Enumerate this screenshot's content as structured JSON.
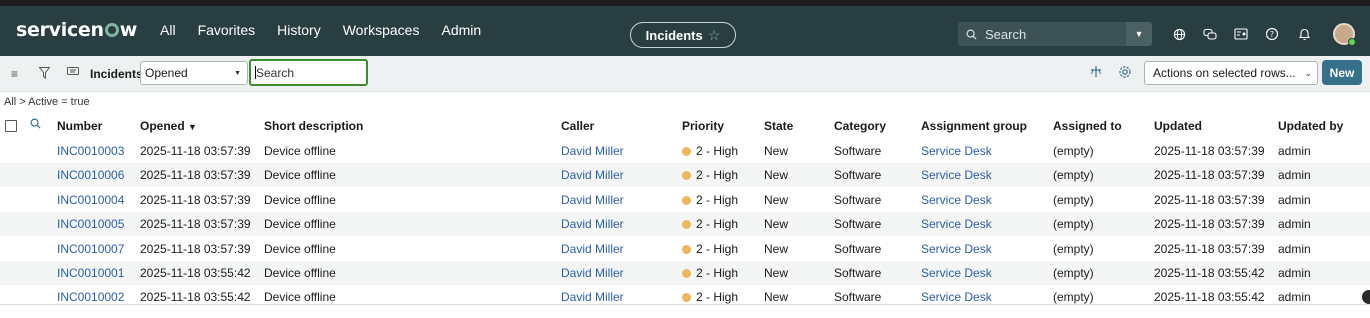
{
  "header": {
    "logo": "servicenow",
    "nav": [
      "All",
      "Favorites",
      "History",
      "Workspaces",
      "Admin"
    ],
    "context_title": "Incidents",
    "search_placeholder": "Search",
    "icons": [
      "globe-icon",
      "chat-icon",
      "id-card-icon",
      "help-icon",
      "bell-icon",
      "avatar"
    ]
  },
  "toolbar": {
    "title": "Incidents",
    "field_select": "Opened",
    "search_placeholder": "Search",
    "actions_select": "Actions on selected rows...",
    "new_label": "New"
  },
  "breadcrumb": "All > Active = true",
  "table": {
    "columns": [
      "Number",
      "Opened",
      "Short description",
      "Caller",
      "Priority",
      "State",
      "Category",
      "Assignment group",
      "Assigned to",
      "Updated",
      "Updated by"
    ],
    "sorted_column": "Opened",
    "sort_glyph": "▼",
    "rows": [
      {
        "number": "INC0010003",
        "opened": "2025-11-18 03:57:39",
        "desc": "Device offline",
        "caller": "David Miller",
        "priority": "2 - High",
        "state": "New",
        "category": "Software",
        "group": "Service Desk",
        "assigned": "(empty)",
        "updated": "2025-11-18 03:57:39",
        "updated_by": "admin"
      },
      {
        "number": "INC0010006",
        "opened": "2025-11-18 03:57:39",
        "desc": "Device offline",
        "caller": "David Miller",
        "priority": "2 - High",
        "state": "New",
        "category": "Software",
        "group": "Service Desk",
        "assigned": "(empty)",
        "updated": "2025-11-18 03:57:39",
        "updated_by": "admin"
      },
      {
        "number": "INC0010004",
        "opened": "2025-11-18 03:57:39",
        "desc": "Device offline",
        "caller": "David Miller",
        "priority": "2 - High",
        "state": "New",
        "category": "Software",
        "group": "Service Desk",
        "assigned": "(empty)",
        "updated": "2025-11-18 03:57:39",
        "updated_by": "admin"
      },
      {
        "number": "INC0010005",
        "opened": "2025-11-18 03:57:39",
        "desc": "Device offline",
        "caller": "David Miller",
        "priority": "2 - High",
        "state": "New",
        "category": "Software",
        "group": "Service Desk",
        "assigned": "(empty)",
        "updated": "2025-11-18 03:57:39",
        "updated_by": "admin"
      },
      {
        "number": "INC0010007",
        "opened": "2025-11-18 03:57:39",
        "desc": "Device offline",
        "caller": "David Miller",
        "priority": "2 - High",
        "state": "New",
        "category": "Software",
        "group": "Service Desk",
        "assigned": "(empty)",
        "updated": "2025-11-18 03:57:39",
        "updated_by": "admin"
      },
      {
        "number": "INC0010001",
        "opened": "2025-11-18 03:55:42",
        "desc": "Device offline",
        "caller": "David Miller",
        "priority": "2 - High",
        "state": "New",
        "category": "Software",
        "group": "Service Desk",
        "assigned": "(empty)",
        "updated": "2025-11-18 03:55:42",
        "updated_by": "admin"
      },
      {
        "number": "INC0010002",
        "opened": "2025-11-18 03:55:42",
        "desc": "Device offline",
        "caller": "David Miller",
        "priority": "2 - High",
        "state": "New",
        "category": "Software",
        "group": "Service Desk",
        "assigned": "(empty)",
        "updated": "2025-11-18 03:55:42",
        "updated_by": "admin"
      }
    ]
  },
  "colors": {
    "header_bg": "#293e40",
    "accent": "#81b5a1",
    "link": "#2c5ea8",
    "priority_high": "#f0b65c",
    "new_button": "#36718b"
  }
}
